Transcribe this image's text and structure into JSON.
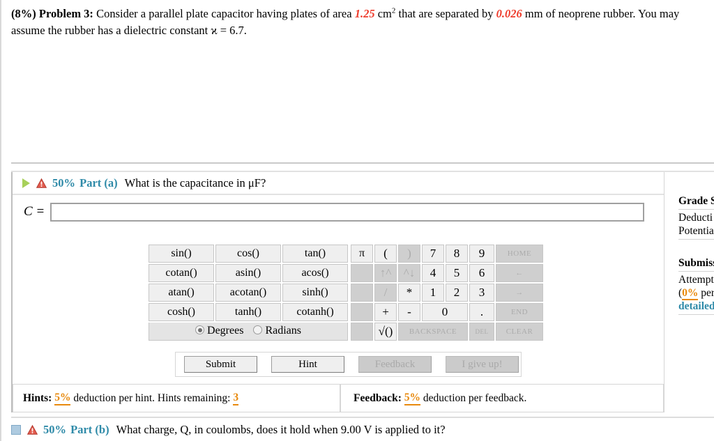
{
  "problem": {
    "percent": "(8%)",
    "label": "Problem 3:",
    "text_1": "Consider a parallel plate capacitor having plates of area",
    "area_value": "1.25",
    "unit_area": "cm",
    "unit_exp": "2",
    "text_2": "that are separated by",
    "separation_value": "0.026",
    "text_3": "mm of neoprene rubber. You may assume the rubber has a dielectric constant ϰ = 6.7."
  },
  "part_a": {
    "play_icon": "play-icon",
    "warn_icon": "warning-icon",
    "percent": "50%",
    "part_label": "Part (a)",
    "question": "What is the capacitance in μF?",
    "answer_var": "C =",
    "answer_value": "",
    "answer_placeholder": ""
  },
  "keypad": {
    "functions": [
      [
        "sin()",
        "cos()",
        "tan()"
      ],
      [
        "cotan()",
        "asin()",
        "acos()"
      ],
      [
        "atan()",
        "acotan()",
        "sinh()"
      ],
      [
        "cosh()",
        "tanh()",
        "cotanh()"
      ]
    ],
    "angle_mode": {
      "degrees_label": "Degrees",
      "radians_label": "Radians",
      "selected": "Degrees"
    },
    "rows": [
      [
        {
          "label": "π",
          "kind": "pi",
          "enabled": true
        },
        {
          "label": "(",
          "kind": "op",
          "enabled": true
        },
        {
          "label": ")",
          "kind": "op",
          "enabled": false
        },
        {
          "label": "7",
          "kind": "num",
          "enabled": true
        },
        {
          "label": "8",
          "kind": "num",
          "enabled": true
        },
        {
          "label": "9",
          "kind": "num",
          "enabled": true
        },
        {
          "label": "HOME",
          "kind": "nav",
          "enabled": false
        }
      ],
      [
        {
          "label": "",
          "kind": "pi",
          "enabled": false
        },
        {
          "label": "↑^",
          "kind": "op",
          "enabled": false
        },
        {
          "label": "^↓",
          "kind": "op",
          "enabled": false
        },
        {
          "label": "4",
          "kind": "num",
          "enabled": true
        },
        {
          "label": "5",
          "kind": "num",
          "enabled": true
        },
        {
          "label": "6",
          "kind": "num",
          "enabled": true
        },
        {
          "label": "←",
          "kind": "nav",
          "enabled": false
        }
      ],
      [
        {
          "label": "",
          "kind": "pi",
          "enabled": false
        },
        {
          "label": "/",
          "kind": "op",
          "enabled": false
        },
        {
          "label": "*",
          "kind": "op",
          "enabled": true
        },
        {
          "label": "1",
          "kind": "num",
          "enabled": true
        },
        {
          "label": "2",
          "kind": "num",
          "enabled": true
        },
        {
          "label": "3",
          "kind": "num",
          "enabled": true
        },
        {
          "label": "→",
          "kind": "nav",
          "enabled": false
        }
      ],
      [
        {
          "label": "",
          "kind": "pi",
          "enabled": false
        },
        {
          "label": "+",
          "kind": "op",
          "enabled": true
        },
        {
          "label": "-",
          "kind": "op",
          "enabled": true
        },
        {
          "label": "0",
          "kind": "num",
          "enabled": true,
          "colspan": 2
        },
        {
          "label": ".",
          "kind": "num",
          "enabled": true
        },
        {
          "label": "END",
          "kind": "nav",
          "enabled": false
        }
      ],
      [
        {
          "label": "",
          "kind": "pi",
          "enabled": false
        },
        {
          "label": "√()",
          "kind": "op",
          "enabled": true
        },
        {
          "label": "BACKSPACE",
          "kind": "bksp",
          "enabled": false,
          "colspan": 3
        },
        {
          "label": "DEL",
          "kind": "del",
          "enabled": false
        },
        {
          "label": "CLEAR",
          "kind": "nav",
          "enabled": false
        }
      ]
    ]
  },
  "actions": {
    "submit": "Submit",
    "hint": "Hint",
    "feedback": "Feedback",
    "give_up": "I give up!"
  },
  "footer": {
    "hints_label": "Hints:",
    "hints_pct": "5%",
    "hints_text": "deduction per hint. Hints remaining:",
    "hints_remaining": "3",
    "feedback_label": "Feedback:",
    "feedback_pct": "5%",
    "feedback_text": "deduction per feedback."
  },
  "part_b": {
    "square_icon": "square-icon",
    "warn_icon": "warning-icon",
    "percent": "50%",
    "part_label": "Part (b)",
    "question": "What charge, Q, in coulombs, does it hold when 9.00 V is applied to it?"
  },
  "sidebar": {
    "grade_summary_head": "Grade S",
    "deductions": "Deducti",
    "potential": "Potentia",
    "submissions_head": "Submiss",
    "attempts": "Attempt",
    "per_line_open": "(",
    "per_pct": "0%",
    "per_line_rest": " per",
    "detailed_link": "detailed"
  },
  "colors": {
    "accent_teal": "#2e8aa8",
    "value_red": "#ee3b2b",
    "orange": "#e8890c",
    "play_green": "#a8d05a"
  }
}
